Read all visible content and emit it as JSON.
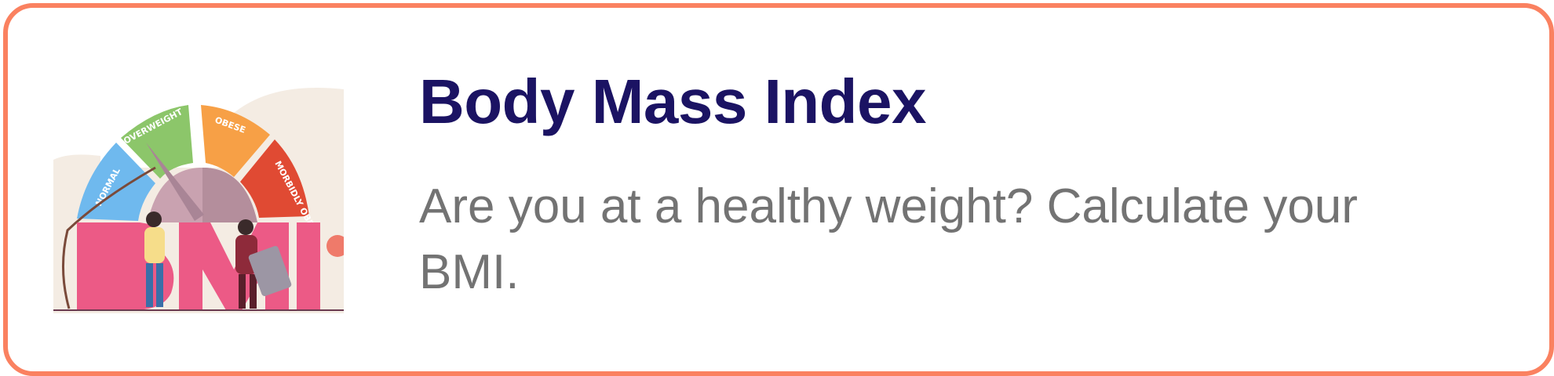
{
  "card": {
    "title": "Body Mass Index",
    "subtitle": "Are you at a healthy weight? Calculate your BMI.",
    "border_color": "#fa8160",
    "title_color": "#1b1363",
    "subtitle_color": "#737373"
  },
  "illustration": {
    "icon": "bmi-gauge-illustration",
    "gauge_labels": [
      "NORMAL",
      "OVERWEIGHT",
      "OBESE",
      "MORBIDLY OBESE"
    ],
    "big_letters": "BMI",
    "colors": {
      "normal": "#6fb9ee",
      "overweight": "#8cc66a",
      "obese": "#f7a046",
      "morbidly_obese": "#e04a33",
      "letters": "#ec5a86",
      "background": "#f4ece3"
    }
  }
}
